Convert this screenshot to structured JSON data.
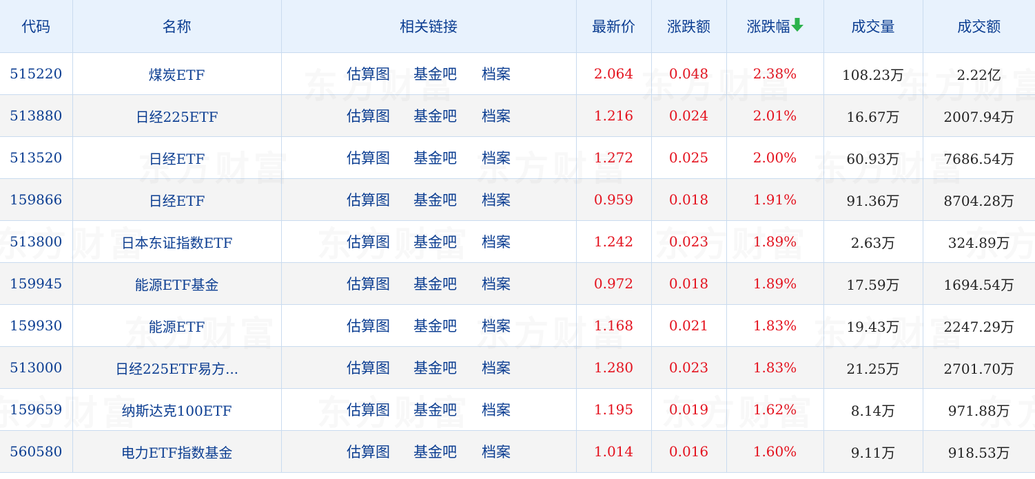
{
  "colors": {
    "header_bg": "#e8f2fd",
    "header_text": "#0b3d91",
    "link": "#0b3d91",
    "up_red": "#e4121e",
    "sort_arrow_green": "#2bb24c",
    "border": "#c9dbef",
    "row_alt_bg": "#f4f4f4"
  },
  "watermark": "东方财富",
  "headers": {
    "code": "代码",
    "name": "名称",
    "links": "相关链接",
    "price": "最新价",
    "change": "涨跌额",
    "pct": "涨跌幅",
    "volume": "成交量",
    "amount": "成交额"
  },
  "sort_icon": "down-arrow-icon",
  "links": [
    "估算图",
    "基金吧",
    "档案"
  ],
  "rows": [
    {
      "code": "515220",
      "name": "煤炭ETF",
      "price": "2.064",
      "change": "0.048",
      "pct": "2.38%",
      "volume": "108.23万",
      "amount": "2.22亿"
    },
    {
      "code": "513880",
      "name": "日经225ETF",
      "price": "1.216",
      "change": "0.024",
      "pct": "2.01%",
      "volume": "16.67万",
      "amount": "2007.94万"
    },
    {
      "code": "513520",
      "name": "日经ETF",
      "price": "1.272",
      "change": "0.025",
      "pct": "2.00%",
      "volume": "60.93万",
      "amount": "7686.54万"
    },
    {
      "code": "159866",
      "name": "日经ETF",
      "price": "0.959",
      "change": "0.018",
      "pct": "1.91%",
      "volume": "91.36万",
      "amount": "8704.28万"
    },
    {
      "code": "513800",
      "name": "日本东证指数ETF",
      "price": "1.242",
      "change": "0.023",
      "pct": "1.89%",
      "volume": "2.63万",
      "amount": "324.89万"
    },
    {
      "code": "159945",
      "name": "能源ETF基金",
      "price": "0.972",
      "change": "0.018",
      "pct": "1.89%",
      "volume": "17.59万",
      "amount": "1694.54万"
    },
    {
      "code": "159930",
      "name": "能源ETF",
      "price": "1.168",
      "change": "0.021",
      "pct": "1.83%",
      "volume": "19.43万",
      "amount": "2247.29万"
    },
    {
      "code": "513000",
      "name": "日经225ETF易方...",
      "price": "1.280",
      "change": "0.023",
      "pct": "1.83%",
      "volume": "21.25万",
      "amount": "2701.70万"
    },
    {
      "code": "159659",
      "name": "纳斯达克100ETF",
      "price": "1.195",
      "change": "0.019",
      "pct": "1.62%",
      "volume": "8.14万",
      "amount": "971.88万"
    },
    {
      "code": "560580",
      "name": "电力ETF指数基金",
      "price": "1.014",
      "change": "0.016",
      "pct": "1.60%",
      "volume": "9.11万",
      "amount": "918.53万"
    }
  ]
}
